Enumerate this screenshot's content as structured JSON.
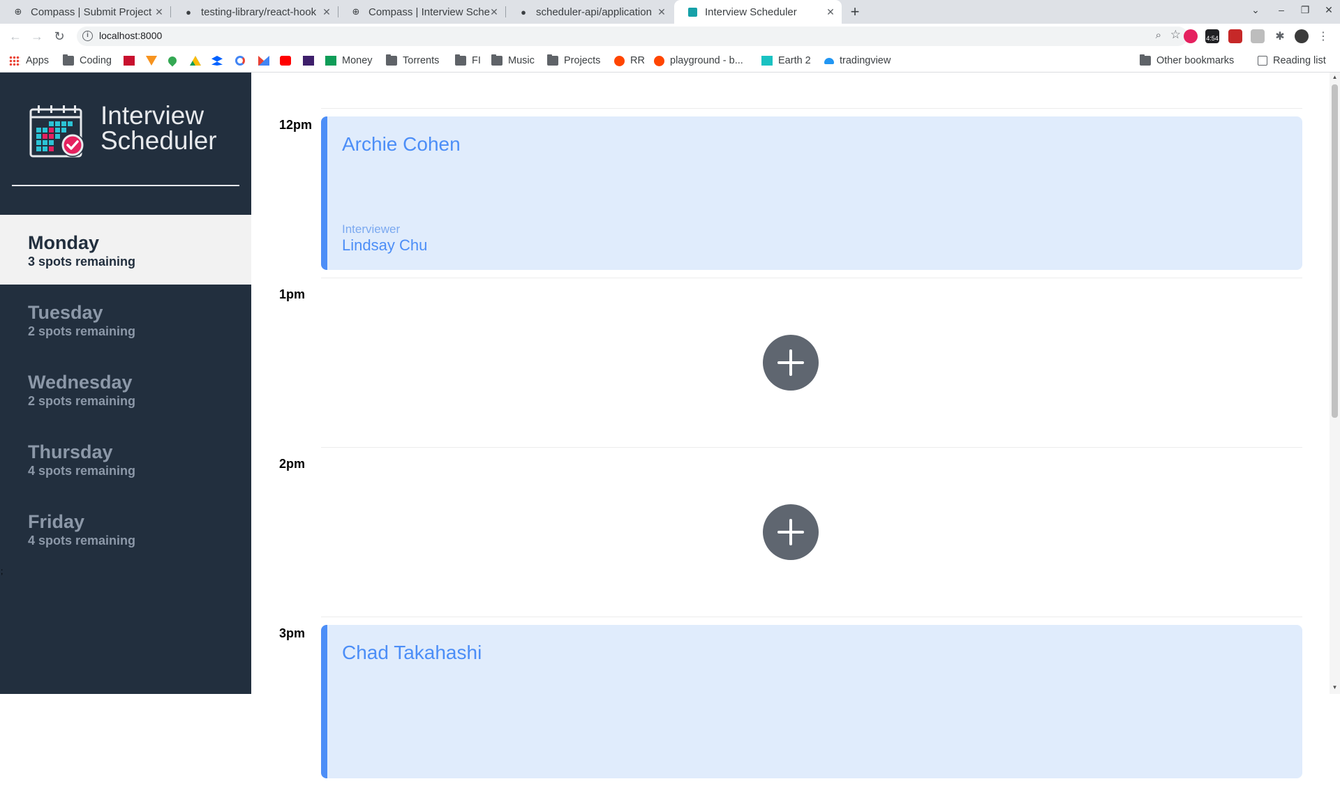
{
  "browser": {
    "tabs": [
      {
        "title": "Compass | Submit Project",
        "icon": "globe-icon"
      },
      {
        "title": "testing-library/react-hook",
        "icon": "github-icon"
      },
      {
        "title": "Compass | Interview Sche",
        "icon": "globe-icon"
      },
      {
        "title": "scheduler-api/application",
        "icon": "github-icon"
      },
      {
        "title": "Interview Scheduler",
        "icon": "app-icon"
      }
    ],
    "close_glyph": "✕",
    "new_tab_glyph": "+",
    "url": "localhost:8000",
    "extension_badge": "4:54",
    "bookmarks": [
      {
        "label": "Apps",
        "kind": "apps"
      },
      {
        "label": "Coding",
        "kind": "folder"
      },
      {
        "label": "Money",
        "kind": "sheet"
      },
      {
        "label": "Torrents",
        "kind": "folder"
      },
      {
        "label": "FI",
        "kind": "folder"
      },
      {
        "label": "Music",
        "kind": "folder"
      },
      {
        "label": "Projects",
        "kind": "folder"
      },
      {
        "label": "RR",
        "kind": "reddit"
      },
      {
        "label": "playground - b...",
        "kind": "reddit"
      },
      {
        "label": "Earth 2",
        "kind": "site"
      },
      {
        "label": "tradingview",
        "kind": "site"
      }
    ],
    "other_bookmarks": "Other bookmarks",
    "reading_list": "Reading list"
  },
  "app": {
    "title_line1": "Interview",
    "title_line2": "Scheduler",
    "days": [
      {
        "name": "Monday",
        "spots": "3 spots remaining",
        "selected": true
      },
      {
        "name": "Tuesday",
        "spots": "2 spots remaining",
        "selected": false
      },
      {
        "name": "Wednesday",
        "spots": "2 spots remaining",
        "selected": false
      },
      {
        "name": "Thursday",
        "spots": "4 spots remaining",
        "selected": false
      },
      {
        "name": "Friday",
        "spots": "4 spots remaining",
        "selected": false
      }
    ],
    "stray_mark": ";",
    "slots": [
      {
        "time": "12pm",
        "student": "Archie Cohen",
        "interviewer_label": "Interviewer",
        "interviewer": "Lindsay Chu"
      },
      {
        "time": "1pm"
      },
      {
        "time": "2pm"
      },
      {
        "time": "3pm",
        "student": "Chad Takahashi"
      }
    ]
  },
  "colors": {
    "sidebar_bg": "#222f3e",
    "appointment_bg": "#e0ecfc",
    "appointment_accent": "#4c8ef7",
    "add_button": "#5f6670"
  }
}
